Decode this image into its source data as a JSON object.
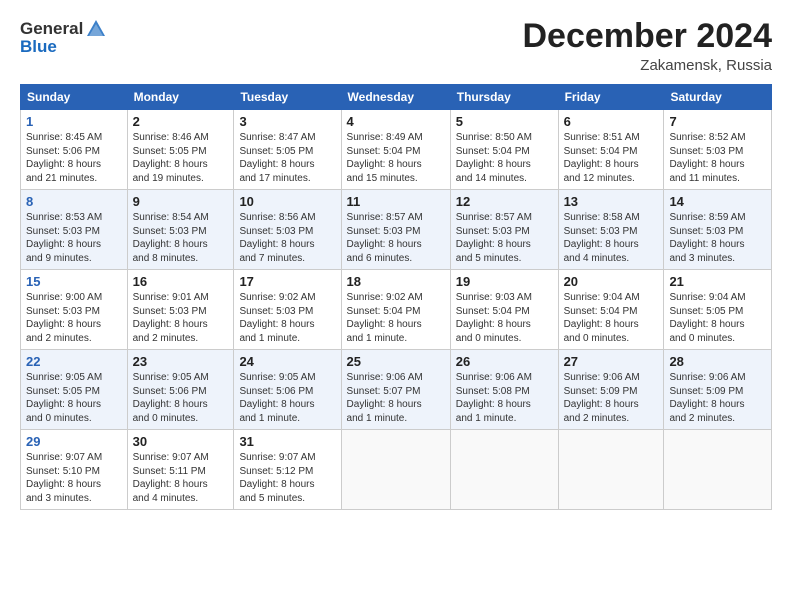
{
  "header": {
    "logo_general": "General",
    "logo_blue": "Blue",
    "month": "December 2024",
    "location": "Zakamensk, Russia"
  },
  "weekdays": [
    "Sunday",
    "Monday",
    "Tuesday",
    "Wednesday",
    "Thursday",
    "Friday",
    "Saturday"
  ],
  "weeks": [
    [
      {
        "day": "1",
        "info": "Sunrise: 8:45 AM\nSunset: 5:06 PM\nDaylight: 8 hours\nand 21 minutes."
      },
      {
        "day": "2",
        "info": "Sunrise: 8:46 AM\nSunset: 5:05 PM\nDaylight: 8 hours\nand 19 minutes."
      },
      {
        "day": "3",
        "info": "Sunrise: 8:47 AM\nSunset: 5:05 PM\nDaylight: 8 hours\nand 17 minutes."
      },
      {
        "day": "4",
        "info": "Sunrise: 8:49 AM\nSunset: 5:04 PM\nDaylight: 8 hours\nand 15 minutes."
      },
      {
        "day": "5",
        "info": "Sunrise: 8:50 AM\nSunset: 5:04 PM\nDaylight: 8 hours\nand 14 minutes."
      },
      {
        "day": "6",
        "info": "Sunrise: 8:51 AM\nSunset: 5:04 PM\nDaylight: 8 hours\nand 12 minutes."
      },
      {
        "day": "7",
        "info": "Sunrise: 8:52 AM\nSunset: 5:03 PM\nDaylight: 8 hours\nand 11 minutes."
      }
    ],
    [
      {
        "day": "8",
        "info": "Sunrise: 8:53 AM\nSunset: 5:03 PM\nDaylight: 8 hours\nand 9 minutes."
      },
      {
        "day": "9",
        "info": "Sunrise: 8:54 AM\nSunset: 5:03 PM\nDaylight: 8 hours\nand 8 minutes."
      },
      {
        "day": "10",
        "info": "Sunrise: 8:56 AM\nSunset: 5:03 PM\nDaylight: 8 hours\nand 7 minutes."
      },
      {
        "day": "11",
        "info": "Sunrise: 8:57 AM\nSunset: 5:03 PM\nDaylight: 8 hours\nand 6 minutes."
      },
      {
        "day": "12",
        "info": "Sunrise: 8:57 AM\nSunset: 5:03 PM\nDaylight: 8 hours\nand 5 minutes."
      },
      {
        "day": "13",
        "info": "Sunrise: 8:58 AM\nSunset: 5:03 PM\nDaylight: 8 hours\nand 4 minutes."
      },
      {
        "day": "14",
        "info": "Sunrise: 8:59 AM\nSunset: 5:03 PM\nDaylight: 8 hours\nand 3 minutes."
      }
    ],
    [
      {
        "day": "15",
        "info": "Sunrise: 9:00 AM\nSunset: 5:03 PM\nDaylight: 8 hours\nand 2 minutes."
      },
      {
        "day": "16",
        "info": "Sunrise: 9:01 AM\nSunset: 5:03 PM\nDaylight: 8 hours\nand 2 minutes."
      },
      {
        "day": "17",
        "info": "Sunrise: 9:02 AM\nSunset: 5:03 PM\nDaylight: 8 hours\nand 1 minute."
      },
      {
        "day": "18",
        "info": "Sunrise: 9:02 AM\nSunset: 5:04 PM\nDaylight: 8 hours\nand 1 minute."
      },
      {
        "day": "19",
        "info": "Sunrise: 9:03 AM\nSunset: 5:04 PM\nDaylight: 8 hours\nand 0 minutes."
      },
      {
        "day": "20",
        "info": "Sunrise: 9:04 AM\nSunset: 5:04 PM\nDaylight: 8 hours\nand 0 minutes."
      },
      {
        "day": "21",
        "info": "Sunrise: 9:04 AM\nSunset: 5:05 PM\nDaylight: 8 hours\nand 0 minutes."
      }
    ],
    [
      {
        "day": "22",
        "info": "Sunrise: 9:05 AM\nSunset: 5:05 PM\nDaylight: 8 hours\nand 0 minutes."
      },
      {
        "day": "23",
        "info": "Sunrise: 9:05 AM\nSunset: 5:06 PM\nDaylight: 8 hours\nand 0 minutes."
      },
      {
        "day": "24",
        "info": "Sunrise: 9:05 AM\nSunset: 5:06 PM\nDaylight: 8 hours\nand 1 minute."
      },
      {
        "day": "25",
        "info": "Sunrise: 9:06 AM\nSunset: 5:07 PM\nDaylight: 8 hours\nand 1 minute."
      },
      {
        "day": "26",
        "info": "Sunrise: 9:06 AM\nSunset: 5:08 PM\nDaylight: 8 hours\nand 1 minute."
      },
      {
        "day": "27",
        "info": "Sunrise: 9:06 AM\nSunset: 5:09 PM\nDaylight: 8 hours\nand 2 minutes."
      },
      {
        "day": "28",
        "info": "Sunrise: 9:06 AM\nSunset: 5:09 PM\nDaylight: 8 hours\nand 2 minutes."
      }
    ],
    [
      {
        "day": "29",
        "info": "Sunrise: 9:07 AM\nSunset: 5:10 PM\nDaylight: 8 hours\nand 3 minutes."
      },
      {
        "day": "30",
        "info": "Sunrise: 9:07 AM\nSunset: 5:11 PM\nDaylight: 8 hours\nand 4 minutes."
      },
      {
        "day": "31",
        "info": "Sunrise: 9:07 AM\nSunset: 5:12 PM\nDaylight: 8 hours\nand 5 minutes."
      },
      {
        "day": "",
        "info": ""
      },
      {
        "day": "",
        "info": ""
      },
      {
        "day": "",
        "info": ""
      },
      {
        "day": "",
        "info": ""
      }
    ]
  ]
}
